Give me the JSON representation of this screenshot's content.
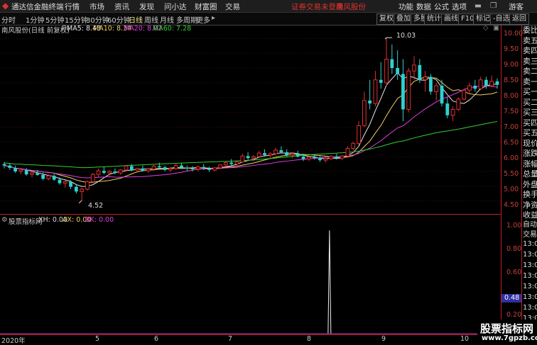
{
  "app": {
    "name": "通达信金融终端",
    "user": "游客"
  },
  "menu": [
    "行情",
    "市场",
    "资讯",
    "发现",
    "问小达",
    "财富圈",
    "交易"
  ],
  "warning": "证券交易未登录",
  "stock_link": "南风股份",
  "menu_right": [
    "功能",
    "数据",
    "公式",
    "选项"
  ],
  "periods": [
    "分时",
    "1分钟",
    "5分钟",
    "15分钟",
    "30分钟",
    "60分钟",
    "日线",
    "周线",
    "月线",
    "多周期",
    "更多"
  ],
  "active_period": "日线",
  "toolbar_right": [
    "复权",
    "叠加",
    "多股",
    "统计",
    "画线",
    "F10",
    "标记",
    "-自选",
    "返回"
  ],
  "main_title": "南风股份(日线 前复权)",
  "ma": [
    {
      "label": "MA5: 8.43",
      "color": "#e8e8e8"
    },
    {
      "label": "MA10: 8.34",
      "color": "#f0d060"
    },
    {
      "label": "MA20: 8.02",
      "color": "#e040e0"
    },
    {
      "label": "MA60: 7.28",
      "color": "#30d030"
    }
  ],
  "price_axis": [
    "10.00",
    "9.50",
    "9.00",
    "8.50",
    "8.00",
    "7.50",
    "7.00",
    "6.50",
    "6.00",
    "5.50",
    "5.00",
    "4.50"
  ],
  "high_label": "10.03",
  "low_label": "4.52",
  "side_labels": [
    "委比",
    "卖五",
    "卖四",
    "卖三",
    "卖二",
    "卖一",
    "买一",
    "买二",
    "买三",
    "买四",
    "买五",
    "现价",
    "涨跌",
    "涨幅",
    "总量",
    "外盘",
    "换手",
    "净资",
    "收益"
  ],
  "indicator": {
    "name": "股票指标网",
    "xh": "XH: 0.00",
    "ax": "AX: 0.00",
    "bk": "BK: 0.00",
    "axis": [
      "1.00",
      "0.80",
      "0.60",
      "0.40",
      "0.20"
    ],
    "current": "0.48"
  },
  "side2": {
    "auto": "自动",
    "trade": "交易",
    "times": [
      "13:0",
      "13:0",
      "13:0",
      "13:0",
      "13:0",
      "13:0",
      "13:0",
      "13:0"
    ]
  },
  "x_axis": [
    "2020年",
    "5",
    "6",
    "7",
    "8",
    "9",
    "10"
  ],
  "watermark": {
    "line1": "股票指标网",
    "line2": "www.7gpzb.com"
  },
  "chart_data": {
    "type": "candlestick",
    "y_range": [
      4.3,
      10.2
    ],
    "ohlc": [
      [
        5.75,
        5.82,
        5.6,
        5.7
      ],
      [
        5.7,
        5.78,
        5.55,
        5.62
      ],
      [
        5.62,
        5.7,
        5.45,
        5.5
      ],
      [
        5.5,
        5.6,
        5.4,
        5.55
      ],
      [
        5.55,
        5.62,
        5.35,
        5.4
      ],
      [
        5.4,
        5.5,
        5.3,
        5.45
      ],
      [
        5.45,
        5.55,
        5.35,
        5.38
      ],
      [
        5.38,
        5.45,
        5.2,
        5.25
      ],
      [
        5.25,
        5.4,
        5.2,
        5.35
      ],
      [
        5.35,
        5.42,
        5.18,
        5.22
      ],
      [
        5.22,
        5.3,
        5.05,
        5.1
      ],
      [
        5.1,
        5.2,
        4.95,
        5.15
      ],
      [
        5.15,
        5.2,
        4.9,
        4.98
      ],
      [
        4.98,
        5.05,
        4.75,
        4.82
      ],
      [
        4.82,
        4.95,
        4.52,
        4.9
      ],
      [
        4.9,
        5.2,
        4.85,
        5.15
      ],
      [
        5.15,
        5.45,
        5.1,
        5.4
      ],
      [
        5.4,
        5.6,
        5.3,
        5.52
      ],
      [
        5.52,
        5.65,
        5.4,
        5.45
      ],
      [
        5.45,
        5.55,
        5.35,
        5.5
      ],
      [
        5.5,
        5.6,
        5.4,
        5.45
      ],
      [
        5.45,
        5.58,
        5.38,
        5.55
      ],
      [
        5.55,
        5.72,
        5.5,
        5.68
      ],
      [
        5.68,
        5.75,
        5.5,
        5.55
      ],
      [
        5.55,
        5.62,
        5.45,
        5.6
      ],
      [
        5.6,
        5.7,
        5.5,
        5.52
      ],
      [
        5.52,
        5.62,
        5.45,
        5.58
      ],
      [
        5.58,
        5.72,
        5.52,
        5.68
      ],
      [
        5.68,
        5.8,
        5.6,
        5.64
      ],
      [
        5.64,
        5.7,
        5.5,
        5.55
      ],
      [
        5.55,
        5.65,
        5.48,
        5.6
      ],
      [
        5.6,
        5.75,
        5.55,
        5.7
      ],
      [
        5.7,
        5.78,
        5.58,
        5.62
      ],
      [
        5.62,
        5.7,
        5.52,
        5.6
      ],
      [
        5.6,
        5.68,
        5.5,
        5.58
      ],
      [
        5.58,
        5.7,
        5.5,
        5.65
      ],
      [
        5.65,
        5.75,
        5.55,
        5.6
      ],
      [
        5.6,
        5.66,
        5.48,
        5.55
      ],
      [
        5.55,
        5.65,
        5.5,
        5.62
      ],
      [
        5.62,
        5.75,
        5.58,
        5.72
      ],
      [
        5.72,
        5.85,
        5.65,
        5.8
      ],
      [
        5.8,
        5.92,
        5.7,
        5.75
      ],
      [
        5.75,
        5.85,
        5.65,
        5.82
      ],
      [
        5.82,
        6.1,
        5.8,
        6.02
      ],
      [
        6.02,
        6.15,
        5.9,
        5.95
      ],
      [
        5.95,
        6.05,
        5.85,
        6.0
      ],
      [
        6.0,
        6.2,
        5.95,
        6.12
      ],
      [
        6.12,
        6.25,
        6.0,
        6.05
      ],
      [
        6.05,
        6.15,
        5.95,
        6.1
      ],
      [
        6.1,
        6.3,
        6.05,
        6.22
      ],
      [
        6.22,
        6.35,
        6.1,
        6.15
      ],
      [
        6.15,
        6.25,
        6.0,
        6.05
      ],
      [
        6.05,
        6.15,
        5.95,
        6.1
      ],
      [
        6.1,
        6.2,
        5.98,
        6.0
      ],
      [
        6.0,
        6.1,
        5.85,
        5.92
      ],
      [
        5.92,
        6.05,
        5.85,
        5.98
      ],
      [
        5.98,
        6.08,
        5.9,
        5.95
      ],
      [
        5.95,
        6.02,
        5.82,
        5.88
      ],
      [
        5.88,
        5.98,
        5.8,
        5.93
      ],
      [
        5.93,
        6.05,
        5.88,
        6.0
      ],
      [
        6.0,
        6.1,
        5.9,
        5.95
      ],
      [
        5.95,
        6.05,
        5.88,
        6.02
      ],
      [
        6.02,
        6.35,
        6.0,
        6.28
      ],
      [
        6.28,
        6.5,
        6.2,
        6.45
      ],
      [
        6.45,
        7.2,
        6.4,
        7.05
      ],
      [
        7.05,
        8.2,
        7.0,
        7.9
      ],
      [
        7.9,
        8.6,
        7.6,
        7.8
      ],
      [
        7.8,
        8.9,
        7.7,
        8.6
      ],
      [
        8.6,
        9.2,
        8.3,
        8.5
      ],
      [
        8.5,
        10.03,
        8.4,
        9.3
      ],
      [
        9.3,
        9.8,
        8.8,
        9.0
      ],
      [
        9.0,
        9.6,
        8.6,
        8.8
      ],
      [
        8.8,
        9.3,
        7.2,
        7.6
      ],
      [
        7.6,
        9.0,
        7.5,
        8.9
      ],
      [
        8.9,
        9.4,
        8.6,
        9.1
      ],
      [
        9.1,
        9.3,
        8.5,
        8.6
      ],
      [
        8.6,
        8.9,
        8.2,
        8.7
      ],
      [
        8.7,
        8.8,
        8.1,
        8.2
      ],
      [
        8.2,
        8.5,
        7.9,
        8.4
      ],
      [
        8.4,
        8.6,
        7.7,
        7.8
      ],
      [
        7.8,
        8.0,
        7.3,
        7.4
      ],
      [
        7.4,
        7.7,
        7.2,
        7.6
      ],
      [
        7.6,
        8.0,
        7.55,
        7.95
      ],
      [
        7.95,
        8.3,
        7.9,
        8.25
      ],
      [
        8.25,
        8.5,
        8.1,
        8.4
      ],
      [
        8.4,
        8.6,
        8.2,
        8.3
      ],
      [
        8.3,
        8.7,
        8.25,
        8.6
      ],
      [
        8.6,
        8.7,
        8.3,
        8.4
      ],
      [
        8.4,
        8.75,
        8.35,
        8.55
      ],
      [
        8.55,
        8.65,
        8.3,
        8.43
      ]
    ],
    "indicator_axis_range": [
      0,
      1.05
    ],
    "indicator_spike": {
      "bar_index": 60,
      "value": 1.0
    }
  }
}
